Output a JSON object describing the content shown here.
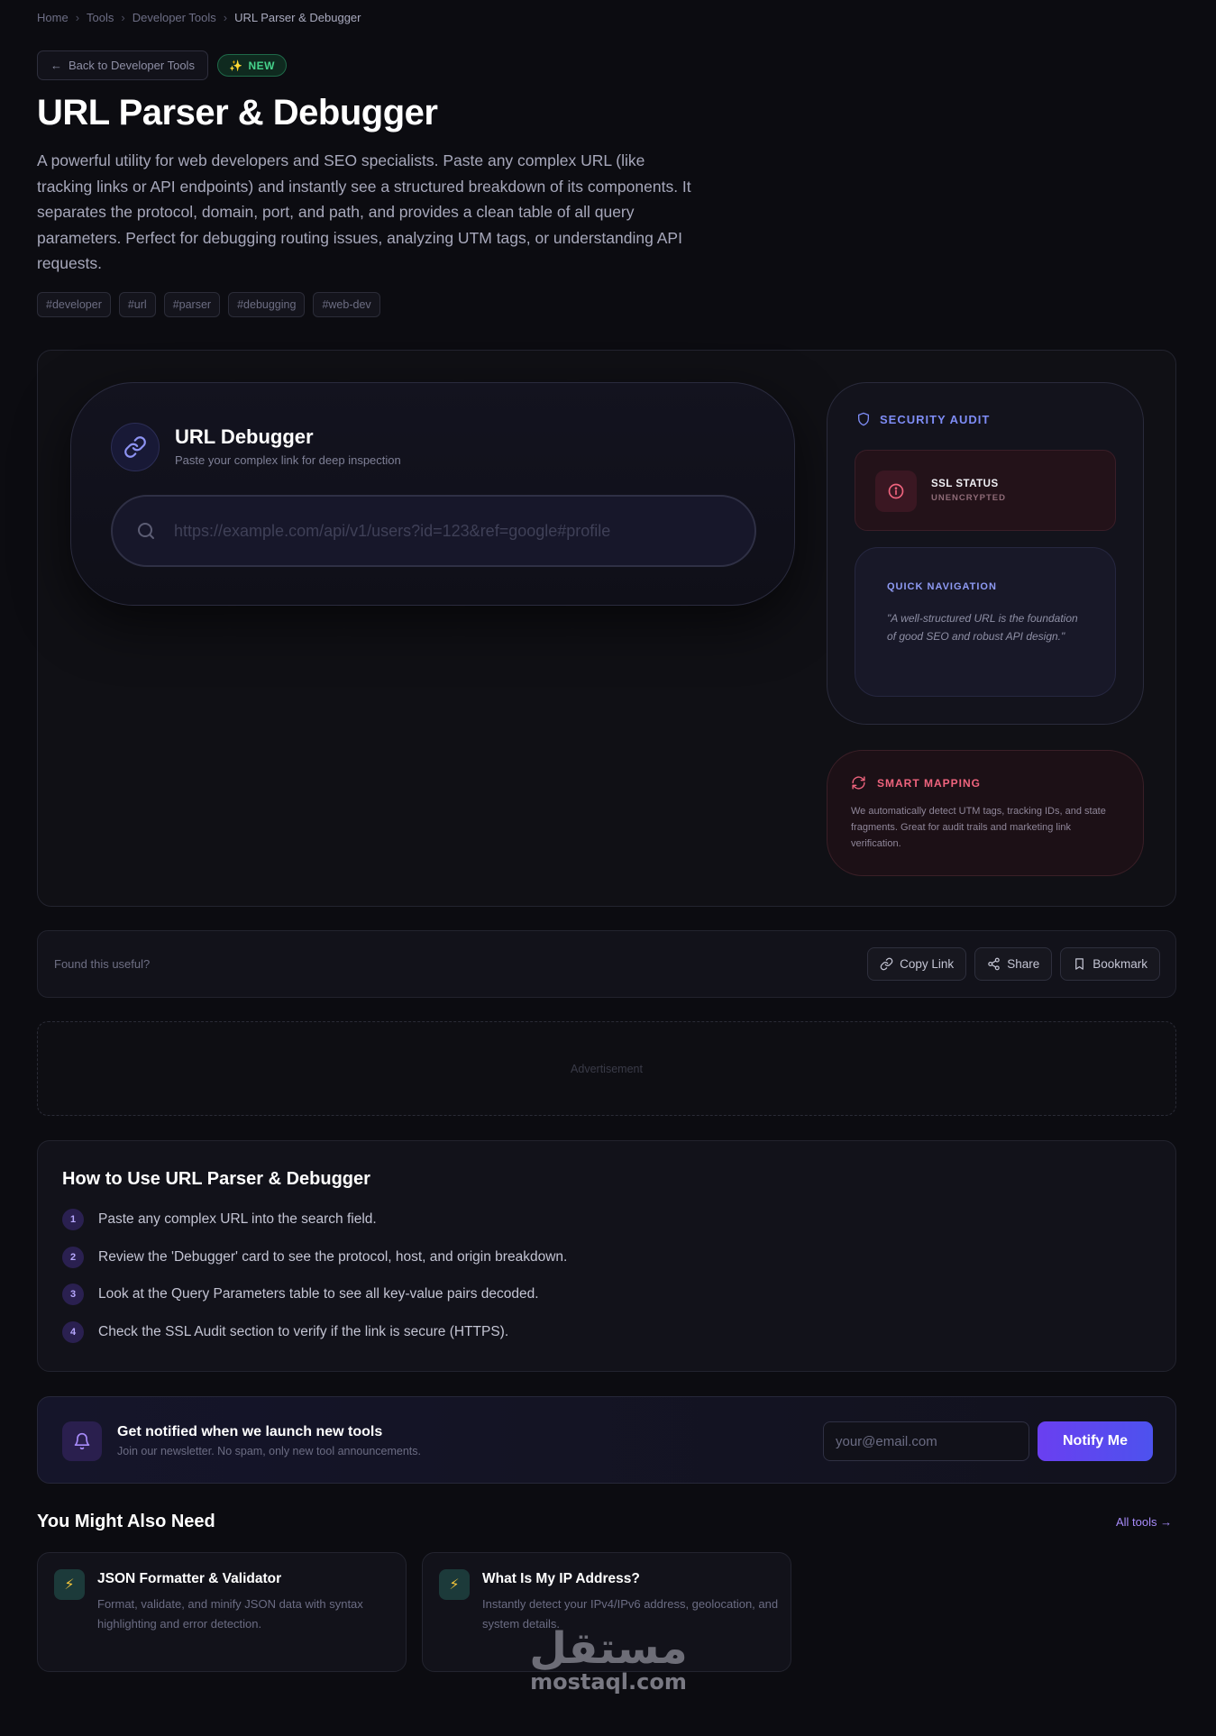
{
  "breadcrumb": [
    "Home",
    "Tools",
    "Developer Tools",
    "URL Parser & Debugger"
  ],
  "header": {
    "back_label": "Back to Developer Tools",
    "badge": "NEW",
    "title": "URL Parser & Debugger",
    "description": "A powerful utility for web developers and SEO specialists. Paste any complex URL (like tracking links or API endpoints) and instantly see a structured breakdown of its components. It separates the protocol, domain, port, and path, and provides a clean table of all query parameters. Perfect for debugging routing issues, analyzing UTM tags, or understanding API requests.",
    "tags": [
      "#developer",
      "#url",
      "#parser",
      "#debugging",
      "#web-dev"
    ]
  },
  "debugger": {
    "icon": "link-icon",
    "title": "URL Debugger",
    "subtitle": "Paste your complex link for deep inspection",
    "input_placeholder": "https://example.com/api/v1/users?id=123&ref=google#profile",
    "input_value": ""
  },
  "security": {
    "heading": "SECURITY AUDIT",
    "ssl_label": "SSL STATUS",
    "ssl_value": "UNENCRYPTED",
    "quick_nav_heading": "QUICK NAVIGATION",
    "quick_nav_quote": "\"A well-structured URL is the foundation of good SEO and robust API design.\""
  },
  "smart_mapping": {
    "heading": "SMART MAPPING",
    "text": "We automatically detect UTM tags, tracking IDs, and state fragments. Great for audit trails and marketing link verification."
  },
  "feedback": {
    "prompt": "Found this useful?",
    "copy_label": "Copy Link",
    "share_label": "Share",
    "bookmark_label": "Bookmark"
  },
  "ad": {
    "label": "Advertisement"
  },
  "howto": {
    "title": "How to Use URL Parser & Debugger",
    "steps": [
      {
        "num": "1",
        "text": "Paste any complex URL into the search field."
      },
      {
        "num": "2",
        "text": "Review the 'Debugger' card to see the protocol, host, and origin breakdown."
      },
      {
        "num": "3",
        "text": "Look at the Query Parameters table to see all key-value pairs decoded."
      },
      {
        "num": "4",
        "text": "Check the SSL Audit section to verify if the link is secure (HTTPS)."
      }
    ]
  },
  "newsletter": {
    "title": "Get notified when we launch new tools",
    "subtitle": "Join our newsletter. No spam, only new tool announcements.",
    "email_placeholder": "your@email.com",
    "button": "Notify Me"
  },
  "related": {
    "title": "You Might Also Need",
    "all_tools": "All tools →",
    "cards": [
      {
        "title": "JSON Formatter & Validator",
        "desc": "Format, validate, and minify JSON data with syntax highlighting and error detection."
      },
      {
        "title": "What Is My IP Address?",
        "desc": "Instantly detect your IPv4/IPv6 address, geolocation, and system details."
      }
    ]
  },
  "watermark": {
    "arabic": "مستقل",
    "latin": "mostaql.com"
  },
  "colors": {
    "accent": "#6a3ff0",
    "success": "#46d38c",
    "danger": "#f0647e",
    "link": "#a78bfa"
  }
}
